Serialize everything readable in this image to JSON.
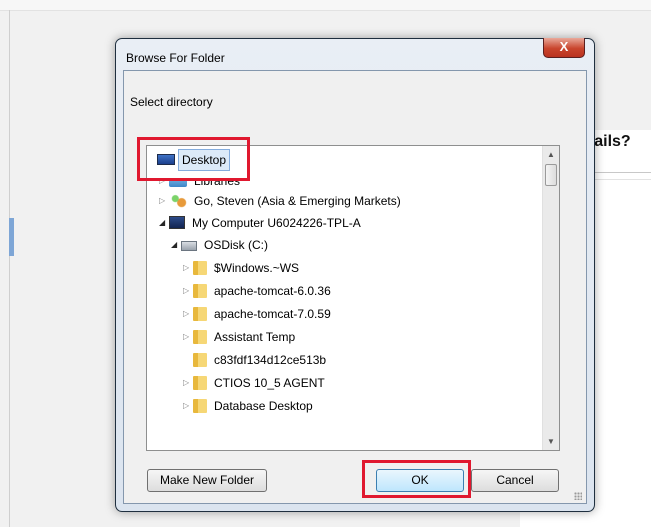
{
  "background": {
    "heading_partial": "etails?"
  },
  "dialog": {
    "title": "Browse For Folder",
    "close_label": "X",
    "prompt": "Select directory",
    "tree": [
      {
        "label": "Desktop",
        "icon": "desktop-icon",
        "expander": "",
        "selected": true
      },
      {
        "label": "Libraries",
        "icon": "libraries-icon",
        "expander": "collapsed"
      },
      {
        "label": "Go, Steven (Asia & Emerging Markets)",
        "icon": "user-folder-icon",
        "expander": "collapsed"
      },
      {
        "label": "My Computer U6024226-TPL-A",
        "icon": "computer-icon",
        "expander": "expanded"
      },
      {
        "label": "OSDisk (C:)",
        "icon": "drive-icon",
        "expander": "expanded"
      },
      {
        "label": "$Windows.~WS",
        "icon": "folder-icon",
        "expander": "collapsed"
      },
      {
        "label": "apache-tomcat-6.0.36",
        "icon": "folder-icon",
        "expander": "collapsed"
      },
      {
        "label": "apache-tomcat-7.0.59",
        "icon": "folder-icon",
        "expander": "collapsed"
      },
      {
        "label": "Assistant Temp",
        "icon": "folder-icon",
        "expander": "collapsed"
      },
      {
        "label": "c83fdf134d12ce513b",
        "icon": "folder-icon",
        "expander": ""
      },
      {
        "label": "CTIOS 10_5 AGENT",
        "icon": "folder-icon",
        "expander": "collapsed"
      },
      {
        "label": "Database Desktop",
        "icon": "folder-icon",
        "expander": "collapsed"
      }
    ],
    "buttons": {
      "make_new_folder": "Make New Folder",
      "ok": "OK",
      "cancel": "Cancel"
    },
    "highlight_color": "#e0182f"
  }
}
